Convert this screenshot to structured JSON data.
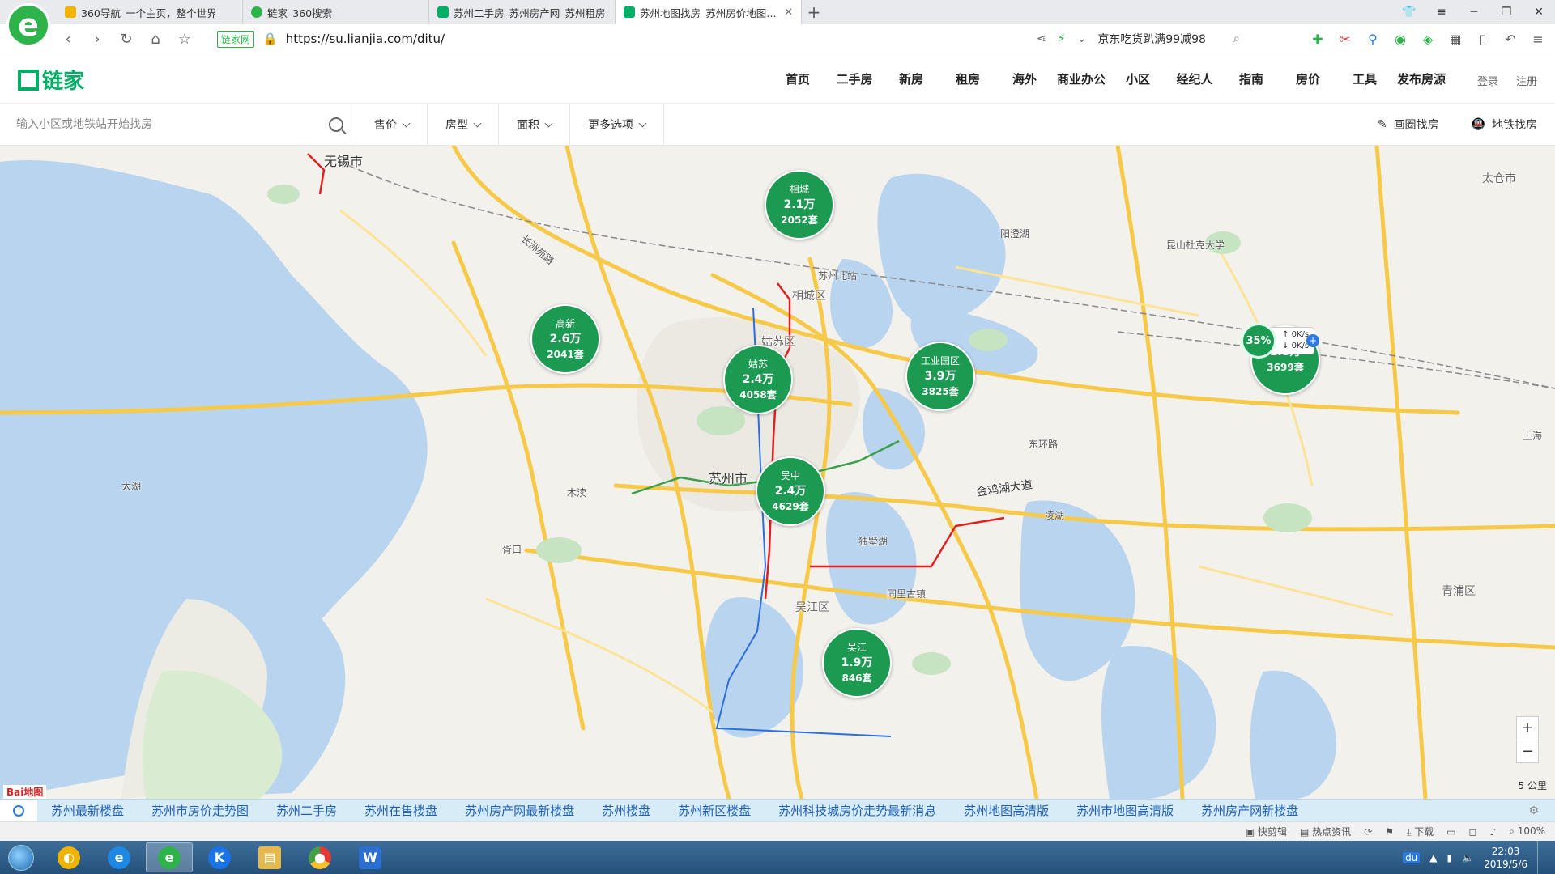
{
  "browser": {
    "tabs": [
      {
        "title": "360导航_一个主页，整个世界",
        "color": "#f0b400"
      },
      {
        "title": "链家_360搜索",
        "color": "#2db34a"
      },
      {
        "title": "苏州二手房_苏州房产网_苏州租房",
        "color": "#00ae66"
      },
      {
        "title": "苏州地图找房_苏州房价地图(苏州",
        "color": "#00ae66",
        "active": true
      }
    ],
    "new_tab": "+",
    "site_badge": "链家网",
    "url": "https://su.lianjia.com/ditu/",
    "promo": "京东吃货趴满99减98"
  },
  "site": {
    "brand": "链家",
    "nav": [
      "首页",
      "二手房",
      "新房",
      "租房",
      "海外",
      "商业办公",
      "小区",
      "经纪人",
      "指南",
      "房价",
      "工具",
      "发布房源"
    ],
    "login": "登录",
    "register": "注册"
  },
  "filters": {
    "search_placeholder": "输入小区或地铁站开始找房",
    "items": [
      "售价",
      "房型",
      "面积",
      "更多选项"
    ],
    "draw_search": "画圈找房",
    "metro_search": "地铁找房"
  },
  "map": {
    "clusters": [
      {
        "name": "相城",
        "price": "2.1万",
        "count": "2052套"
      },
      {
        "name": "高新",
        "price": "2.6万",
        "count": "2041套"
      },
      {
        "name": "姑苏",
        "price": "2.4万",
        "count": "4058套"
      },
      {
        "name": "工业园区",
        "price": "3.9万",
        "count": "3825套"
      },
      {
        "name": "吴中",
        "price": "2.4万",
        "count": "4629套"
      },
      {
        "name": "吴江",
        "price": "1.9万",
        "count": "846套"
      },
      {
        "name": "",
        "price": "1.8万",
        "count": "3699套"
      }
    ],
    "labels": {
      "wuxi": "无锡市",
      "suzhou": "苏州市",
      "xiangcheng_dist": "相城区",
      "wuzhong_dist": "吴江区",
      "gusu_dist": "姑苏区",
      "taicang": "太仓市",
      "qingpu": "青浦区",
      "suzhou_north": "苏州北站",
      "jinji": "金鸡湖大道",
      "yangcheng": "阳澄湖",
      "dushu": "独墅湖",
      "taihu": "太湖",
      "changzhou": "长洲苑路",
      "dongfang": "东环路",
      "kunshan": "昆山杜克大学",
      "xukou": "胥口",
      "mudu": "木渎",
      "tongli": "同里古镇",
      "linghu": "凌湖",
      "shanghai": "上海"
    },
    "speed": {
      "percent": "35%",
      "up": "0K/s",
      "down": "0K/s"
    },
    "zoom_in": "+",
    "zoom_out": "−",
    "scale": "5 公里",
    "baidu": "Bai地图"
  },
  "links": [
    "苏州最新楼盘",
    "苏州市房价走势图",
    "苏州二手房",
    "苏州在售楼盘",
    "苏州房产网最新楼盘",
    "苏州楼盘",
    "苏州新区楼盘",
    "苏州科技城房价走势最新消息",
    "苏州地图高清版",
    "苏州市地图高清版",
    "苏州房产网新楼盘"
  ],
  "status": {
    "items": [
      "快剪辑",
      "热点资讯",
      "下载",
      "100%"
    ]
  },
  "taskbar": {
    "time": "22:03",
    "date": "2019/5/6",
    "tray_badge": "du"
  }
}
